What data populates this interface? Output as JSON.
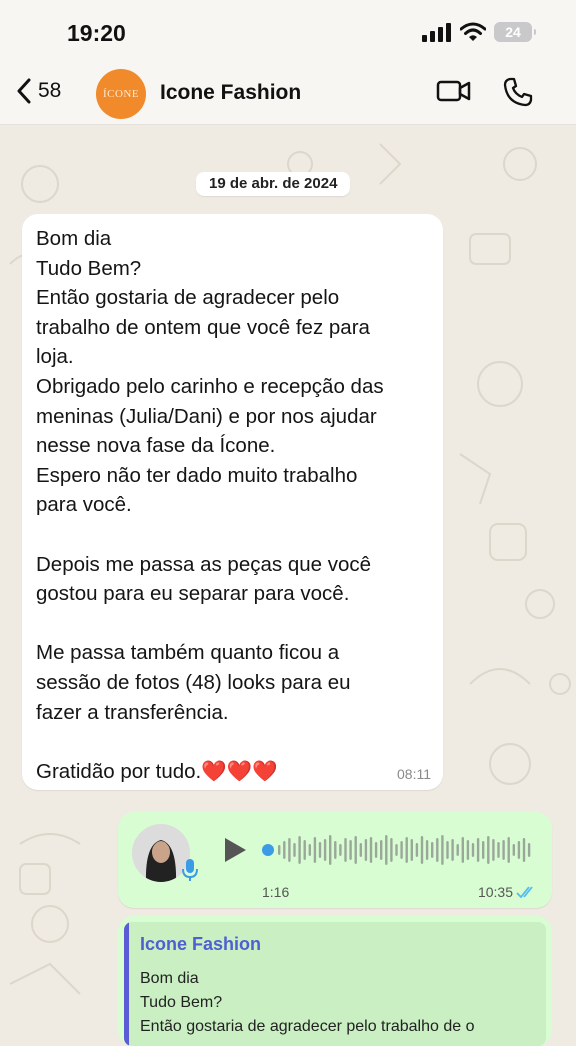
{
  "status_bar": {
    "time": "19:20",
    "battery": "24"
  },
  "header": {
    "back_count": "58",
    "avatar_text": "ÍCONE",
    "chat_name": "Icone Fashion"
  },
  "date_chip": "19 de abr. de 2024",
  "incoming": {
    "lines": [
      "Bom dia",
      "Tudo Bem?",
      "Então gostaria de agradecer pelo",
      "trabalho de ontem que você fez para",
      "loja.",
      "Obrigado pelo carinho e recepção das",
      "meninas (Julia/Dani) e por nos ajudar",
      "nesse nova fase da Ícone.",
      "Espero não ter dado muito trabalho",
      "para você.",
      "",
      "Depois me passa as peças que você",
      "gostou para eu separar para você.",
      "",
      "Me passa também quanto ficou a",
      "sessão de fotos (48) looks para eu",
      "fazer a transferência.",
      "",
      "Gratidão por tudo.❤️❤️❤️"
    ],
    "time": "08:11"
  },
  "voice": {
    "duration": "1:16",
    "time": "10:35"
  },
  "reply": {
    "quote_author": "Icone Fashion",
    "quote_lines": [
      "Bom dia",
      "Tudo Bem?",
      "Então gostaria de agradecer pelo trabalho de o"
    ]
  },
  "colors": {
    "bubble_out": "#d9fdd3",
    "bubble_in": "#ffffff",
    "quote_accent": "#5b5bd6",
    "read_ticks": "#53bdeb",
    "avatar_bg": "#f08a2a"
  },
  "icons": [
    "signal-icon",
    "wifi-icon",
    "battery-icon",
    "back-chevron-icon",
    "video-call-icon",
    "phone-icon",
    "play-icon",
    "mic-icon",
    "read-ticks-icon"
  ]
}
